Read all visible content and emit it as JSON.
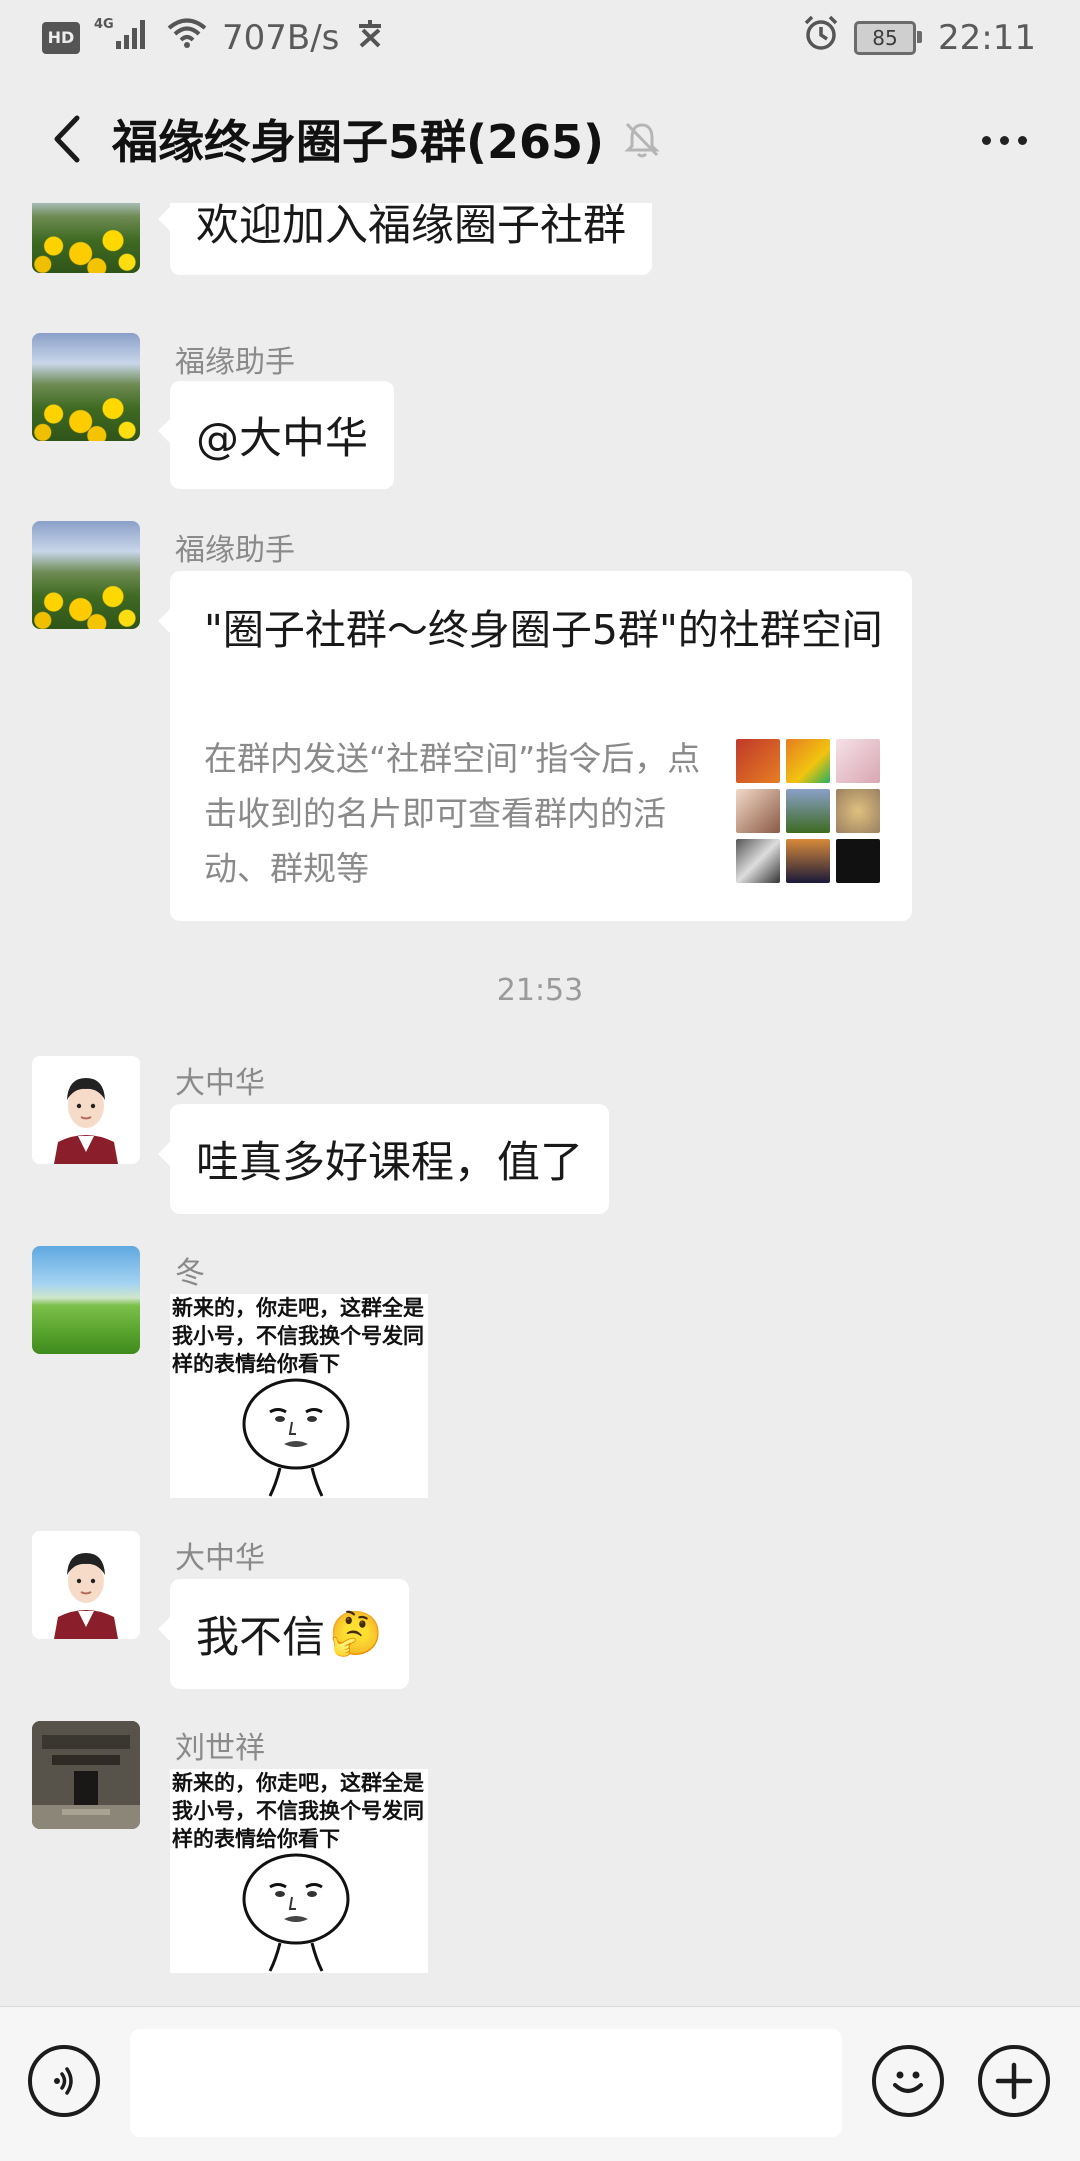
{
  "status_bar": {
    "network_badge": "HD",
    "network_type": "4G",
    "speed": "707B/s",
    "battery": "85",
    "time": "22:11"
  },
  "nav": {
    "title": "福缘终身圈子5群(265)",
    "muted": true
  },
  "messages": [
    {
      "sender": "",
      "text": "欢迎加入福缘圈子社群"
    },
    {
      "sender": "福缘助手",
      "text": "@大中华"
    },
    {
      "sender": "福缘助手",
      "card": {
        "title": "\"圈子社群～终身圈子5群\"的社群空间",
        "description": "在群内发送“社群空间”指令后，点击收到的名片即可查看群内的活动、群规等"
      }
    },
    {
      "time_divider": "21:53"
    },
    {
      "sender": "大中华",
      "text": "哇真多好课程，值了"
    },
    {
      "sender": "冬",
      "sticker_text": "新来的，你走吧，这群全是我小号，不信我换个号发同样的表情给你看下"
    },
    {
      "sender": "大中华",
      "text": "我不信",
      "emoji": "🤔"
    },
    {
      "sender": "刘世祥",
      "sticker_text": "新来的，你走吧，这群全是我小号，不信我换个号发同样的表情给你看下"
    }
  ],
  "input": {
    "placeholder": ""
  },
  "colors": {
    "background": "#ededed",
    "bubble": "#ffffff",
    "secondary_text": "#8a8a8a"
  }
}
